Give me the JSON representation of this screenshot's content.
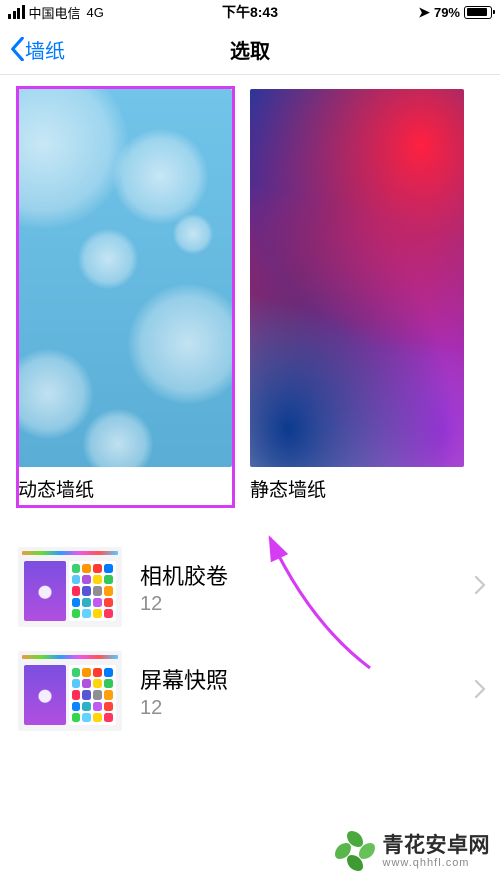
{
  "status_bar": {
    "carrier": "中国电信",
    "network": "4G",
    "time": "下午8:43",
    "location_icon": "location-arrow",
    "battery_pct": "79%"
  },
  "nav": {
    "back_label": "墙纸",
    "title": "选取"
  },
  "tiles": [
    {
      "id": "dynamic",
      "label": "动态墙纸"
    },
    {
      "id": "static",
      "label": "静态墙纸"
    }
  ],
  "albums": [
    {
      "title": "相机胶卷",
      "count": "12"
    },
    {
      "title": "屏幕快照",
      "count": "12"
    }
  ],
  "watermark": {
    "name": "青花安卓网",
    "url": "www.qhhfl.com"
  },
  "annotation": {
    "arrow_color": "#d63cf3",
    "highlight_color": "#d63cf3"
  },
  "home_icon_colors": [
    "#3bd16f",
    "#ff9500",
    "#ff3b30",
    "#007aff",
    "#5ac8fa",
    "#af52de",
    "#ffd60a",
    "#34c759",
    "#ff2d55",
    "#5856d6",
    "#8e8e93",
    "#ff9f0a",
    "#0a84ff",
    "#30b0c7",
    "#bf5af2",
    "#ff453a",
    "#32d74b",
    "#64d2ff",
    "#ffd60a",
    "#ff375f"
  ]
}
